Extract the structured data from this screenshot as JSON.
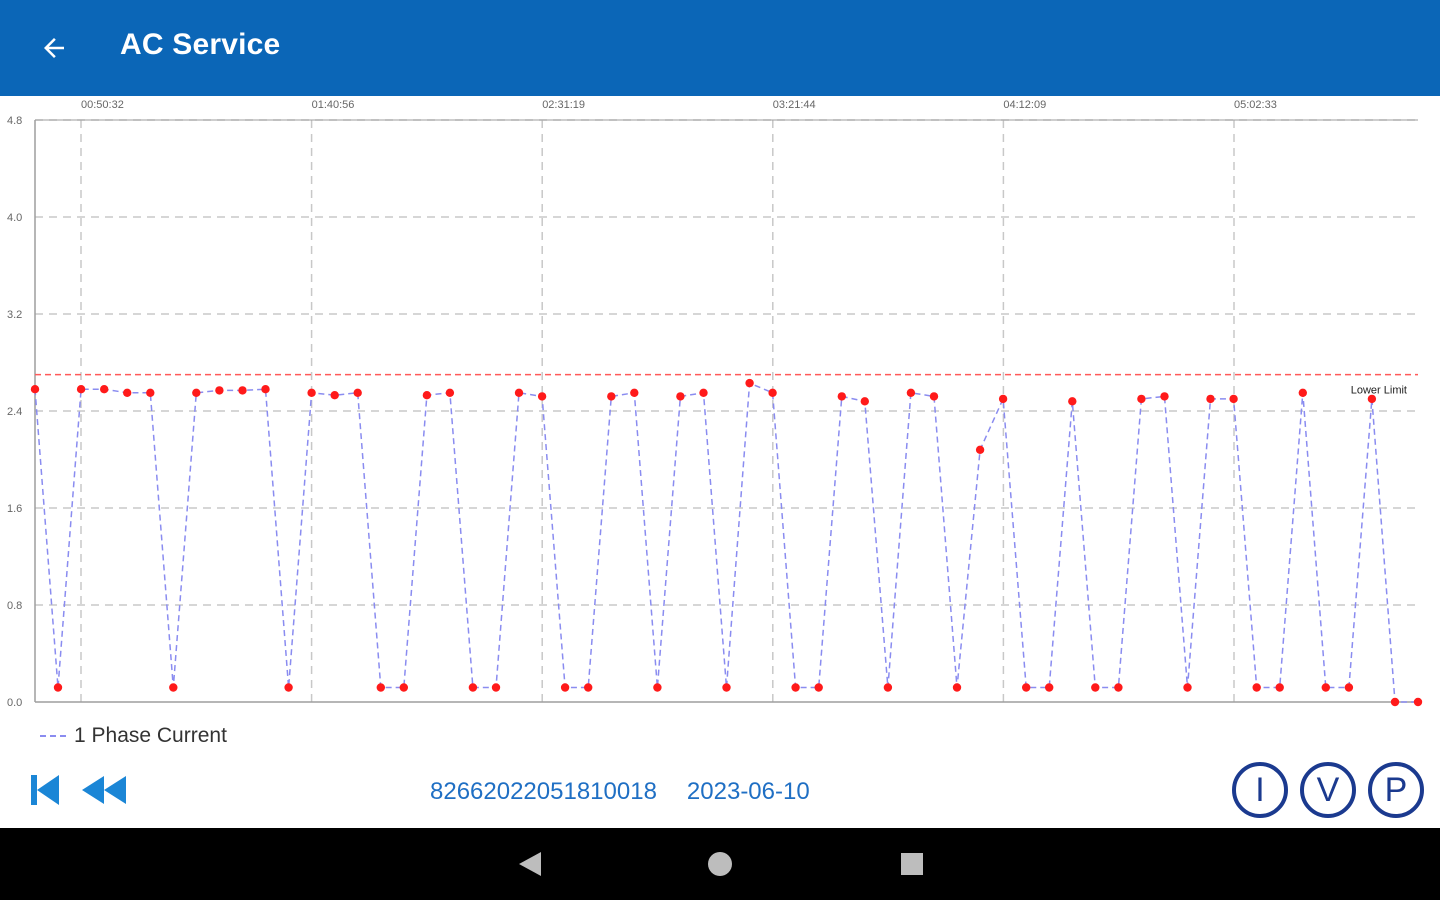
{
  "app_bar": {
    "title": "AC Service",
    "back_icon": "arrow-back-icon"
  },
  "colors": {
    "app_bar": "#0b66b7",
    "series_line": "#8a8cf0",
    "point": "#ff1a1a",
    "limit_line": "#ff5a5a",
    "grid": "#c8c8c8",
    "controls": "#1b86d6",
    "circle_buttons": "#1b3a8f"
  },
  "chart_data": {
    "type": "line",
    "x_tick_labels": [
      "00:50:32",
      "01:40:56",
      "02:31:19",
      "03:21:44",
      "04:12:09",
      "05:02:33"
    ],
    "y_tick_labels": [
      "0.0",
      "0.8",
      "1.6",
      "2.4",
      "3.2",
      "4.0",
      "4.8"
    ],
    "ylim": [
      0,
      4.8
    ],
    "grid": true,
    "series": [
      {
        "name": "1 Phase Current",
        "values": [
          2.58,
          0.12,
          2.58,
          2.58,
          2.55,
          2.55,
          0.12,
          2.55,
          2.57,
          2.57,
          2.58,
          0.12,
          2.55,
          2.53,
          2.55,
          0.12,
          0.12,
          2.53,
          2.55,
          0.12,
          0.12,
          2.55,
          2.52,
          0.12,
          0.12,
          2.52,
          2.55,
          0.12,
          2.52,
          2.55,
          0.12,
          2.63,
          2.55,
          0.12,
          0.12,
          2.52,
          2.48,
          0.12,
          2.55,
          2.52,
          0.12,
          2.08,
          2.5,
          0.12,
          0.12,
          2.48,
          0.12,
          0.12,
          2.5,
          2.52,
          0.12,
          2.5,
          2.5,
          0.12,
          0.12,
          2.55,
          0.12,
          0.12,
          2.5,
          0.0,
          0.0
        ]
      }
    ],
    "limit_line": {
      "label": "Lower Limit",
      "value": 2.7
    }
  },
  "legend": {
    "label": "1 Phase Current"
  },
  "controls": {
    "first_icon": "skip-to-start-icon",
    "rewind_icon": "rewind-icon",
    "device_id": "82662022051810018",
    "date": "2023-06-10",
    "current_button": "I",
    "voltage_button": "V",
    "power_button": "P"
  },
  "nav": {
    "back_icon": "nav-back-icon",
    "home_icon": "nav-home-icon",
    "recents_icon": "nav-recents-icon"
  }
}
